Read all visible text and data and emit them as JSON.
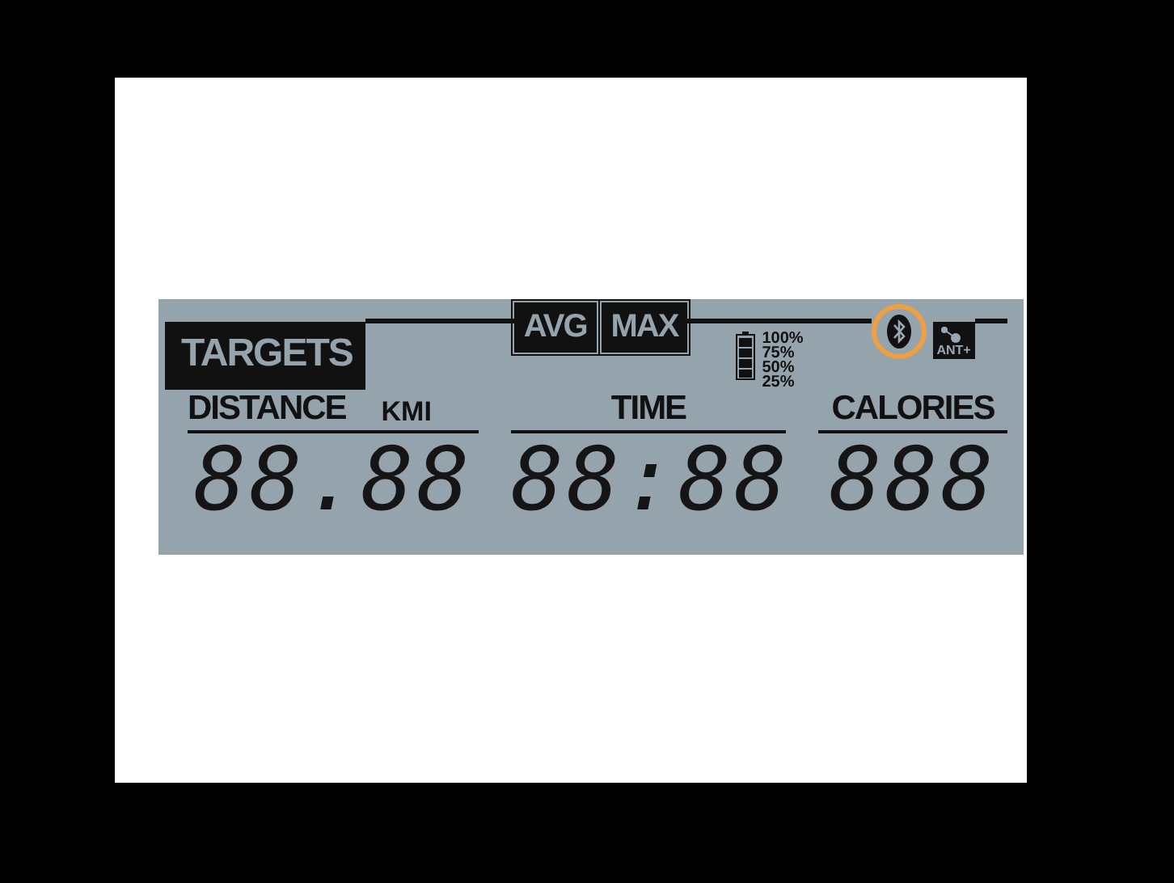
{
  "targets": "TARGETS",
  "modes": [
    {
      "label": "AVG"
    },
    {
      "label": "MAX"
    }
  ],
  "battery": {
    "labels": [
      "100%",
      "75%",
      "50%",
      "25%"
    ]
  },
  "bluetooth": {
    "highlighted": true
  },
  "ant": {
    "label": "ANT+"
  },
  "fields": [
    {
      "label": "DISTANCE",
      "unit": "KMI",
      "value": "88.88"
    },
    {
      "label": "TIME",
      "value": "88:88"
    },
    {
      "label": "CALORIES",
      "value": "888"
    }
  ]
}
